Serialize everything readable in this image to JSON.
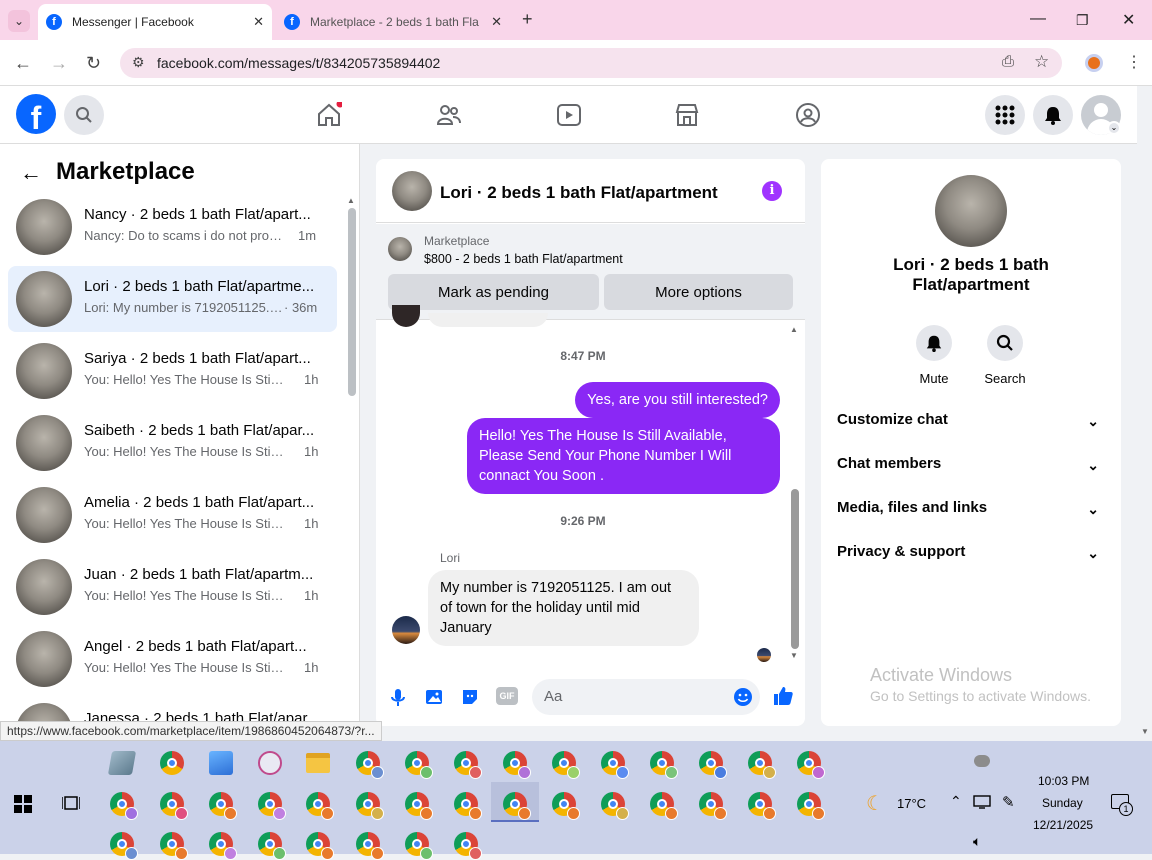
{
  "browser": {
    "tabs": [
      {
        "title": "Messenger | Facebook",
        "active": true
      },
      {
        "title": "Marketplace - 2 beds 1 bath Fla",
        "active": false
      }
    ],
    "url": "facebook.com/messages/t/834205735894402",
    "status_url": "https://www.facebook.com/marketplace/item/1986860452064873/?r..."
  },
  "sidebar": {
    "title": "Marketplace",
    "conversations": [
      {
        "name": "Nancy · 2 beds 1 bath Flat/apart...",
        "preview": "Nancy: Do to scams i do not provi...",
        "time": "1m"
      },
      {
        "name": "Lori · 2 beds 1 bath Flat/apartme...",
        "preview": "Lori: My number is 7192051125. I...",
        "time": "· 36m",
        "selected": true
      },
      {
        "name": "Sariya · 2 beds 1 bath Flat/apart...",
        "preview": "You: Hello! Yes The House Is Still Av...",
        "time": "1h"
      },
      {
        "name": "Saibeth · 2 beds 1 bath Flat/apar...",
        "preview": "You: Hello! Yes The House Is Still Av...",
        "time": "1h"
      },
      {
        "name": "Amelia · 2 beds 1 bath Flat/apart...",
        "preview": "You: Hello! Yes The House Is Still Av...",
        "time": "1h"
      },
      {
        "name": "Juan · 2 beds 1 bath Flat/apartm...",
        "preview": "You: Hello! Yes The House Is Still Av...",
        "time": "1h"
      },
      {
        "name": "Angel · 2 beds 1 bath Flat/apart...",
        "preview": "You: Hello! Yes The House Is Still Av...",
        "time": "1h"
      },
      {
        "name": "Janessa · 2 beds 1 bath Flat/apar...",
        "preview": "",
        "time": ""
      }
    ]
  },
  "chat": {
    "title": "Lori · 2 beds 1 bath Flat/apartment",
    "listing": {
      "label": "Marketplace",
      "price_title": "$800 - 2 beds 1 bath Flat/apartment"
    },
    "buttons": {
      "pending": "Mark as pending",
      "more": "More options"
    },
    "messages": [
      {
        "type": "time",
        "text": "8:47 PM"
      },
      {
        "type": "out",
        "text": "Yes, are you still interested?"
      },
      {
        "type": "out",
        "text": "Hello! Yes The House  Is Still Available, Please Send Your Phone Number I Will connact You Soon ."
      },
      {
        "type": "time",
        "text": "9:26 PM"
      },
      {
        "type": "sender",
        "text": "Lori"
      },
      {
        "type": "in",
        "text": "My number is 7192051125. I am out of town for the holiday until mid January"
      }
    ],
    "composer_placeholder": "Aa"
  },
  "details": {
    "name": "Lori · 2 beds 1 bath Flat/apartment",
    "actions": [
      {
        "label": "Mute",
        "icon": "bell-icon"
      },
      {
        "label": "Search",
        "icon": "search-icon"
      }
    ],
    "sections": [
      "Customize chat",
      "Chat members",
      "Media, files and links",
      "Privacy & support"
    ]
  },
  "watermark": {
    "line1": "Activate Windows",
    "line2": "Go to Settings to activate Windows."
  },
  "taskbar": {
    "temperature": "17°C",
    "time": "10:03 PM",
    "day": "Sunday",
    "date": "12/21/2025",
    "notifications": "1"
  },
  "colors": {
    "brand": "#0866ff",
    "outgoing_bubble": "#8a28f5",
    "tabbar": "#f9d6ea",
    "taskbar": "#cbd2e9"
  }
}
